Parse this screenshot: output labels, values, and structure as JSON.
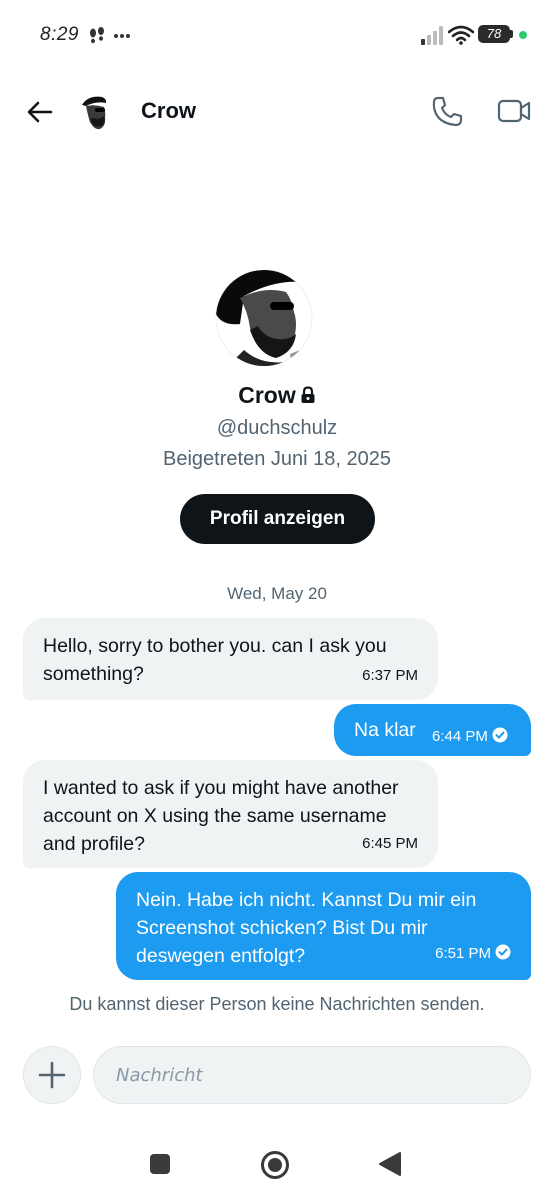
{
  "status_bar": {
    "time": "8:29",
    "battery": "78"
  },
  "header": {
    "name": "Crow"
  },
  "profile": {
    "name": "Crow",
    "handle": "@duchschulz",
    "joined": "Beigetreten Juni 18, 2025",
    "view_button": "Profil anzeigen"
  },
  "date_separator": "Wed, May 20",
  "messages": [
    {
      "direction": "incoming",
      "text": "Hello, sorry to bother you. can I ask you something?",
      "time": "6:37 PM"
    },
    {
      "direction": "outgoing",
      "text": "Na klar",
      "time": "6:44 PM",
      "status": "read"
    },
    {
      "direction": "incoming",
      "text": "I wanted to ask if you might have another account on X using the same username and profile?",
      "time": "6:45 PM"
    },
    {
      "direction": "outgoing",
      "text": "Nein. Habe ich nicht. Kannst Du mir ein Screenshot schicken? Bist Du mir deswegen entfolgt?",
      "time": "6:51 PM",
      "status": "read"
    }
  ],
  "notice": "Du kannst dieser Person keine Nachrichten senden.",
  "composer": {
    "placeholder": "Nachricht"
  },
  "colors": {
    "accent": "#1d9bf0",
    "incoming_bubble": "#eff3f4",
    "text": "#0f1419",
    "muted": "#536471"
  }
}
